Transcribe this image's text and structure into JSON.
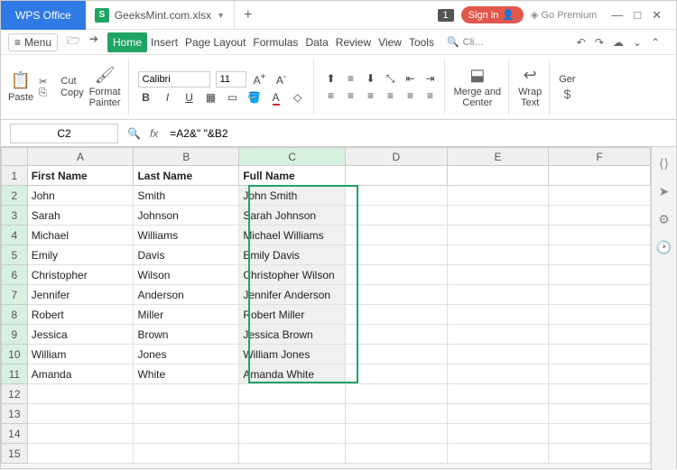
{
  "titlebar": {
    "appName": "WPS Office",
    "fileName": "GeeksMint.com.xlsx",
    "fileIcon": "S",
    "badge": "1",
    "signIn": "Sign in",
    "goPremium": "Go Premium"
  },
  "menu": {
    "menuLabel": "Menu",
    "tabs": [
      "Home",
      "Insert",
      "Page Layout",
      "Formulas",
      "Data",
      "Review",
      "View",
      "Tools"
    ],
    "activeTab": "Home",
    "searchPlaceholder": "Cli…"
  },
  "ribbon": {
    "paste": "Paste",
    "cut": "Cut",
    "copy": "Copy",
    "formatPainter": "Format\nPainter",
    "font": "Calibri",
    "size": "11",
    "mergeCenter": "Merge and\nCenter",
    "wrapText": "Wrap\nText",
    "ger": "Ger"
  },
  "formula": {
    "cellRef": "C2",
    "value": "=A2&\" \"&B2"
  },
  "sheet": {
    "columns": [
      "A",
      "B",
      "C",
      "D",
      "E",
      "F"
    ],
    "activeCol": "C",
    "headerRow": [
      "First Name",
      "Last Name",
      "Full Name",
      "",
      "",
      ""
    ],
    "rows": [
      {
        "n": 2,
        "c": [
          "John",
          "Smith",
          "John Smith",
          "",
          "",
          ""
        ]
      },
      {
        "n": 3,
        "c": [
          "Sarah",
          "Johnson",
          "Sarah Johnson",
          "",
          "",
          ""
        ]
      },
      {
        "n": 4,
        "c": [
          "Michael",
          "Williams",
          "Michael Williams",
          "",
          "",
          ""
        ]
      },
      {
        "n": 5,
        "c": [
          "Emily",
          "Davis",
          "Emily Davis",
          "",
          "",
          ""
        ]
      },
      {
        "n": 6,
        "c": [
          "Christopher",
          "Wilson",
          "Christopher Wilson",
          "",
          "",
          ""
        ]
      },
      {
        "n": 7,
        "c": [
          "Jennifer",
          "Anderson",
          "Jennifer Anderson",
          "",
          "",
          ""
        ]
      },
      {
        "n": 8,
        "c": [
          "Robert",
          "Miller",
          "Robert Miller",
          "",
          "",
          ""
        ]
      },
      {
        "n": 9,
        "c": [
          "Jessica",
          "Brown",
          "Jessica Brown",
          "",
          "",
          ""
        ]
      },
      {
        "n": 10,
        "c": [
          "William",
          "Jones",
          "William Jones",
          "",
          "",
          ""
        ]
      },
      {
        "n": 11,
        "c": [
          "Amanda",
          "White",
          "Amanda White",
          "",
          "",
          ""
        ]
      },
      {
        "n": 12,
        "c": [
          "",
          "",
          "",
          "",
          "",
          ""
        ]
      },
      {
        "n": 13,
        "c": [
          "",
          "",
          "",
          "",
          "",
          ""
        ]
      },
      {
        "n": 14,
        "c": [
          "",
          "",
          "",
          "",
          "",
          ""
        ]
      },
      {
        "n": 15,
        "c": [
          "",
          "",
          "",
          "",
          "",
          ""
        ]
      }
    ],
    "selectedCol": 2,
    "selectedRowStart": 2,
    "selectedRowEnd": 11
  }
}
